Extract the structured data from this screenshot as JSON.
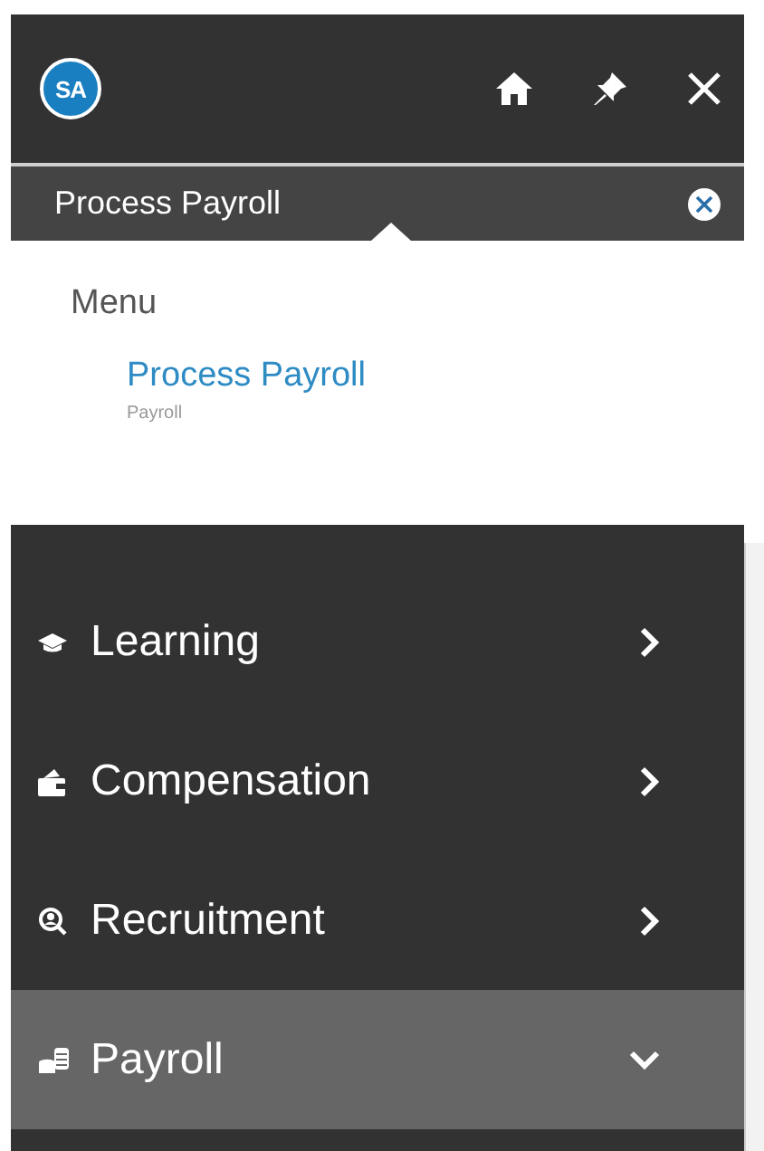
{
  "user": {
    "initials": "SA"
  },
  "search": {
    "value": "Process Payroll"
  },
  "results": {
    "heading": "Menu",
    "items": [
      {
        "title": "Process Payroll",
        "category": "Payroll"
      }
    ]
  },
  "nav": [
    {
      "label": "Learning",
      "kind": "learning",
      "selected": false,
      "expanded": false
    },
    {
      "label": "Compensation",
      "kind": "compensation",
      "selected": false,
      "expanded": false
    },
    {
      "label": "Recruitment",
      "kind": "recruitment",
      "selected": false,
      "expanded": false
    },
    {
      "label": "Payroll",
      "kind": "payroll",
      "selected": true,
      "expanded": true
    }
  ]
}
